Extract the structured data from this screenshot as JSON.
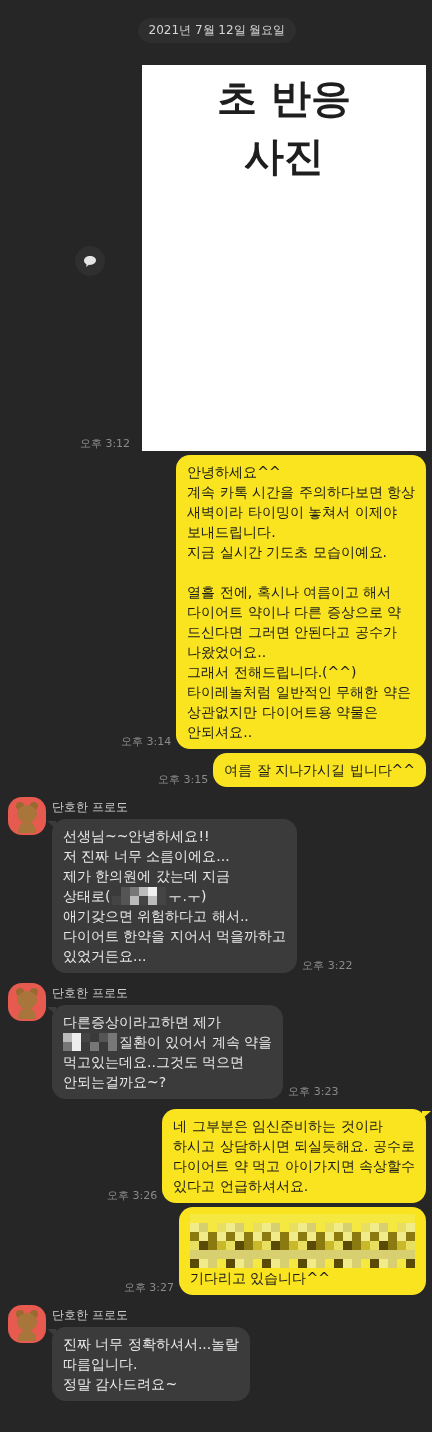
{
  "date_divider": "2021년 7월 12일 월요일",
  "messages": [
    {
      "kind": "image",
      "outgoing": true,
      "caption": "초 반응\n사진",
      "time": "오후 3:12"
    },
    {
      "kind": "text",
      "outgoing": true,
      "time": "오후 3:14",
      "body": [
        {
          "kind": "text",
          "text": "안녕하세요^^\n계속 카톡 시간을 주의하다보면 항상\n새벽이라 타이밍이 놓쳐서 이제야\n보내드립니다.\n지금 실시간 기도초 모습이예요.\n\n열흘 전에, 혹시나 여름이고 해서\n다이어트 약이나 다른 증상으로 약\n드신다면 그러면 안된다고 공수가\n나왔었어요..\n그래서 전해드립니다.(^^)\n타이레놀처럼 일반적인 무해한 약은\n상관없지만 다이어트용 약물은\n안되셔요.."
        }
      ]
    },
    {
      "kind": "text",
      "outgoing": true,
      "time": "오후 3:15",
      "body": [
        {
          "kind": "text",
          "text": "여름 잘 지나가시길 빕니다^^"
        }
      ]
    },
    {
      "kind": "text",
      "outgoing": false,
      "name": "단호한 프로도",
      "time": "오후 3:22",
      "body": [
        {
          "kind": "text",
          "text": "선생님~~안녕하세요!!\n저 진짜 너무 소름이에요...\n제가 한의원에 갔는데 지금"
        },
        {
          "kind": "line",
          "parts": [
            {
              "kind": "text",
              "text": "상태로("
            },
            {
              "kind": "mosaic"
            },
            {
              "kind": "text",
              "text": "ㅜ.ㅜ)"
            }
          ]
        },
        {
          "kind": "text",
          "text": "애기갖으면 위험하다고 해서..\n다이어트 한약을 지어서 먹을까하고\n있었거든요..."
        }
      ]
    },
    {
      "kind": "text",
      "outgoing": false,
      "name": "단호한 프로도",
      "time": "오후 3:23",
      "body": [
        {
          "kind": "text",
          "text": "다른증상이라고하면 제가"
        },
        {
          "kind": "line",
          "parts": [
            {
              "kind": "mosaic"
            },
            {
              "kind": "text",
              "text": "질환이 있어서 계속 약을"
            }
          ]
        },
        {
          "kind": "text",
          "text": "먹고있는데요..그것도 먹으면\n안되는걸까요~?"
        }
      ]
    },
    {
      "kind": "text",
      "outgoing": true,
      "time": "오후 3:26",
      "body": [
        {
          "kind": "text",
          "text": "네 그부분은 임신준비하는 것이라\n하시고 상담하시면 되실듯해요. 공수로\n다이어트 약 먹고 아이가지면 속상할수\n있다고 언급하셔서요."
        }
      ]
    },
    {
      "kind": "text",
      "outgoing": true,
      "time": "오후 3:27",
      "body": [
        {
          "kind": "mosaic_block"
        },
        {
          "kind": "text",
          "text": "기다리고 있습니다^^"
        }
      ]
    },
    {
      "kind": "text",
      "outgoing": false,
      "name": "단호한 프로도",
      "body": [
        {
          "kind": "text",
          "text": "진짜 너무 정확하셔서...놀랄\n따름입니다.\n정말 감사드려요~"
        }
      ]
    }
  ]
}
